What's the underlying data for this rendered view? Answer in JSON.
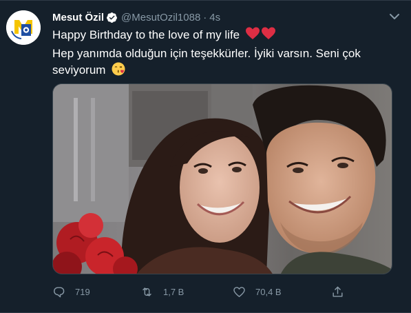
{
  "tweet": {
    "author_name": "Mesut Özil",
    "handle": "@MesutOzil1088",
    "separator": "·",
    "time": "4s",
    "verified": true,
    "text_line1": "Happy Birthday to the love of my life",
    "text_line1_emoji": "two-red-hearts",
    "text_line2": "Hep yanımda olduğun için teşekkürler. İyiki varsın. Seni çok",
    "text_line3": "seviyorum",
    "text_line3_emoji": "face-blowing-a-kiss",
    "media_alt": "selfie photo of a couple"
  },
  "actions": {
    "reply_count": "719",
    "retweet_count": "1,7 B",
    "like_count": "70,4 B"
  },
  "colors": {
    "background": "#15202b",
    "text_primary": "#ffffff",
    "text_secondary": "#8899a6",
    "verified_blue": "#1da1f2",
    "avatar_yellow": "#f5c400",
    "avatar_blue": "#1f4fa3",
    "heart_red": "#e0245e"
  },
  "icons": {
    "reply": "speech-bubble-icon",
    "retweet": "retweet-icon",
    "like": "heart-icon",
    "share": "share-icon",
    "more": "more-icon"
  }
}
